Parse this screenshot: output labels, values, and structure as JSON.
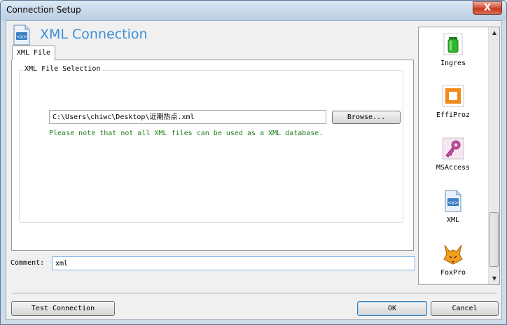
{
  "window": {
    "title": "Connection Setup",
    "close_symbol": "X"
  },
  "header": {
    "title": "XML Connection",
    "icon": "xml-file-icon"
  },
  "tabs": [
    {
      "label": "XML File",
      "active": true
    }
  ],
  "file_selection": {
    "group_label": "XML File Selection",
    "path_value": "C:\\Users\\chiwc\\Desktop\\近期热点.xml",
    "browse_label": "Browse...",
    "note": "Please note that not all XML files can be used as a XML database."
  },
  "database_types": [
    {
      "label": "Ingres",
      "icon": "ingres-icon"
    },
    {
      "label": "EffiProz",
      "icon": "effiproz-icon"
    },
    {
      "label": "MSAccess",
      "icon": "msaccess-icon"
    },
    {
      "label": "XML",
      "icon": "xml-icon"
    },
    {
      "label": "FoxPro",
      "icon": "foxpro-icon"
    }
  ],
  "comment": {
    "label": "Comment:",
    "value": "xml"
  },
  "buttons": {
    "test": "Test Connection",
    "ok": "OK",
    "cancel": "Cancel"
  },
  "colors": {
    "title_accent": "#3b8fd6",
    "note_text": "#1a7a1a",
    "focus_border": "#7eb4ea"
  }
}
